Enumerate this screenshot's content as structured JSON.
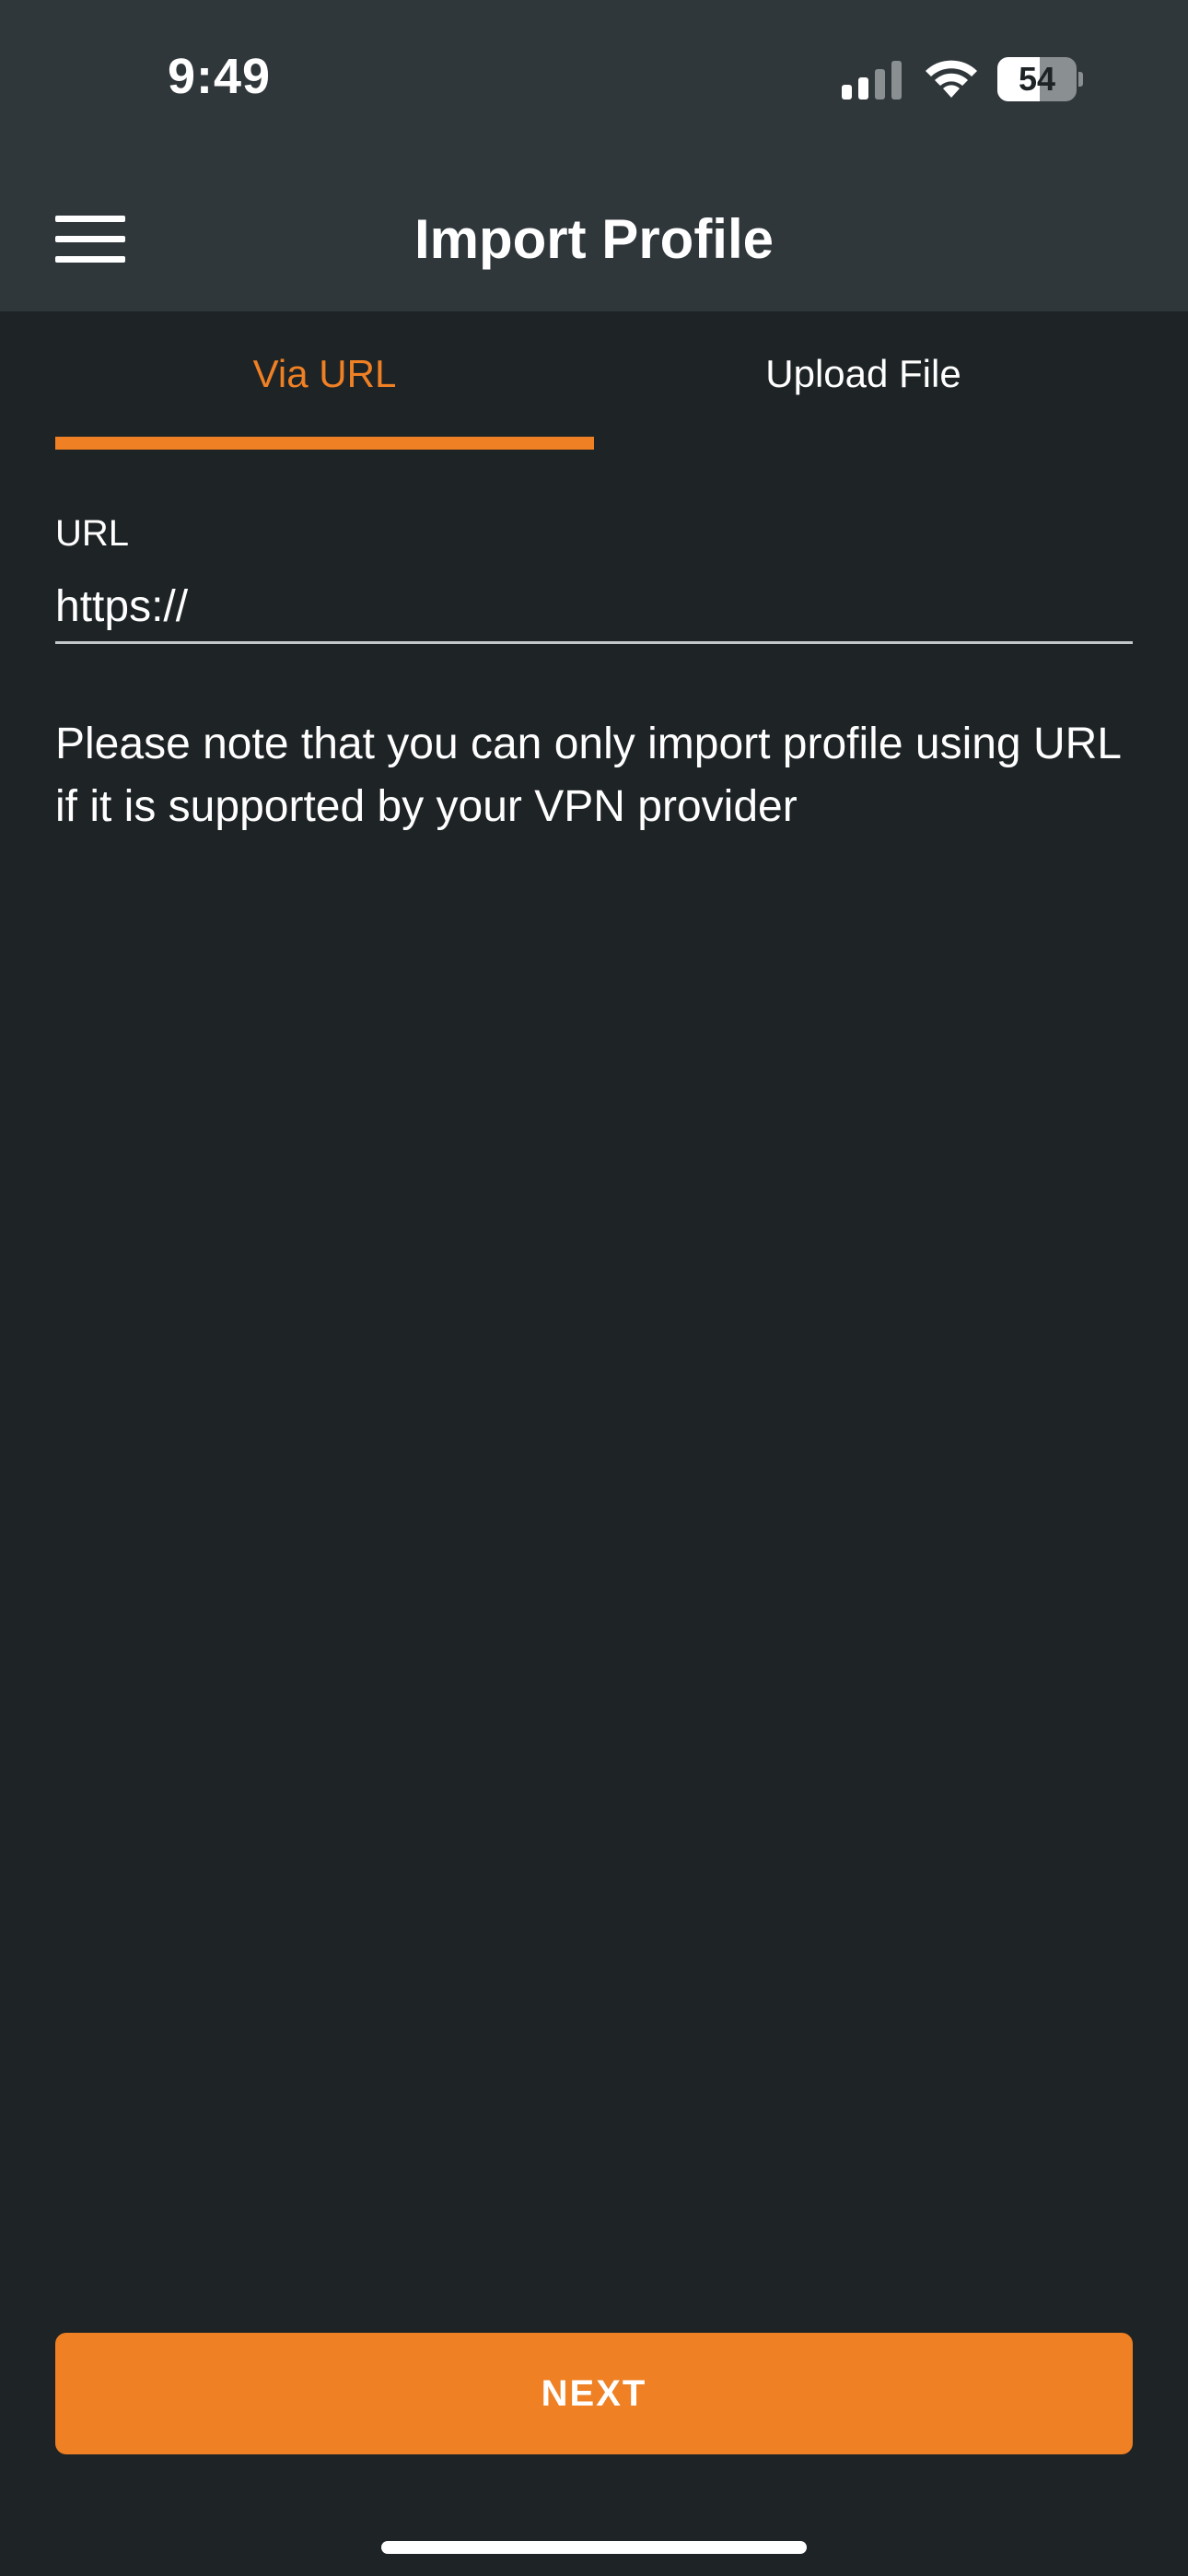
{
  "status_bar": {
    "time": "9:49",
    "battery_level": "54",
    "battery_fraction": 0.54
  },
  "header": {
    "title": "Import Profile",
    "menu_icon": "hamburger-menu-icon"
  },
  "tabs": [
    {
      "label": "Via URL",
      "active": true
    },
    {
      "label": "Upload File",
      "active": false
    }
  ],
  "url_field": {
    "label": "URL",
    "value": "https://"
  },
  "note": "Please note that you can only import profile using URL if it is supported by your VPN provider",
  "next_button": {
    "label": "NEXT"
  },
  "colors": {
    "accent": "#ef8024",
    "header_bg": "#30373b",
    "page_bg": "#1e2326"
  }
}
